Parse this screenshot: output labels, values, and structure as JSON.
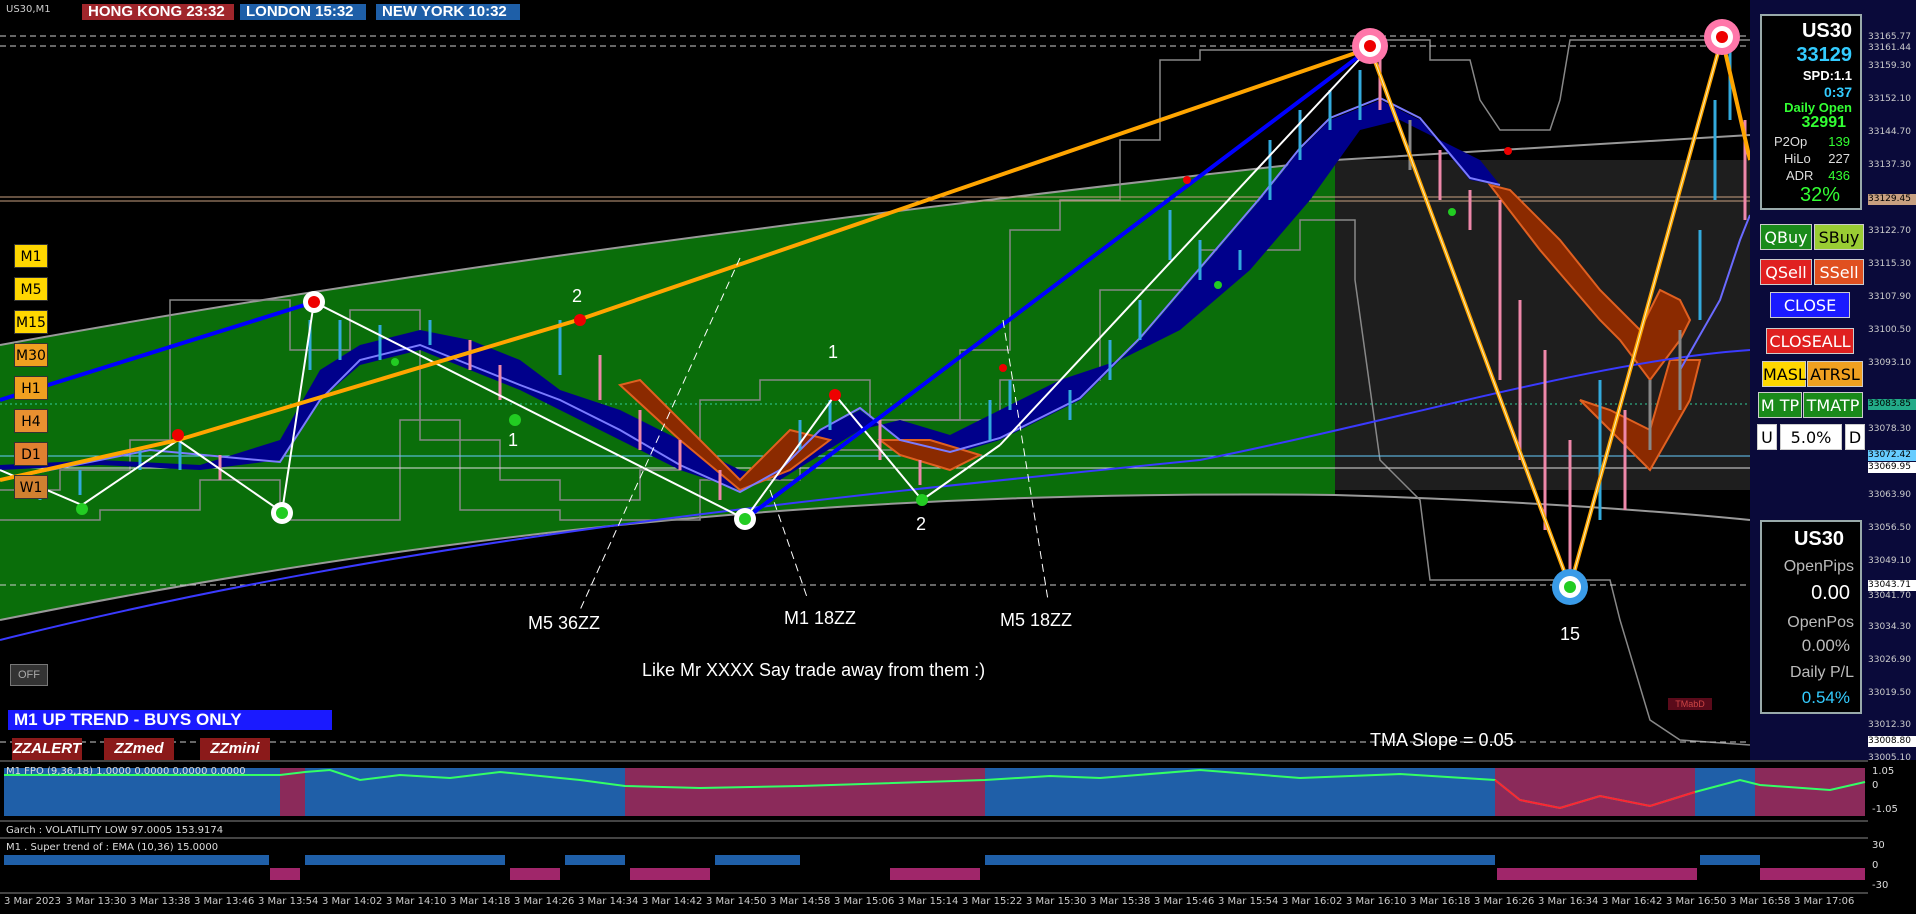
{
  "window": {
    "symbol_label": "US30,M1"
  },
  "clocks": [
    {
      "label": "HONG KONG 23:32",
      "color": "#a0262b"
    },
    {
      "label": "LONDON  15:32",
      "color": "#1e5fa8"
    },
    {
      "label": "NEW YORK  10:32",
      "color": "#1e5fa8"
    }
  ],
  "timeframes": [
    {
      "label": "M1",
      "color": "#ffd700"
    },
    {
      "label": "M5",
      "color": "#ffd700"
    },
    {
      "label": "M15",
      "color": "#ffd700"
    },
    {
      "label": "M30",
      "color": "#f0a020"
    },
    {
      "label": "H1",
      "color": "#f0a020"
    },
    {
      "label": "H4",
      "color": "#e89030"
    },
    {
      "label": "D1",
      "color": "#e08030"
    },
    {
      "label": "W1",
      "color": "#d08030"
    }
  ],
  "off_button": "OFF",
  "trend_banner": "M1 UP TREND - BUYS ONLY",
  "zz_buttons": [
    "ZZALERT",
    "ZZmed",
    "ZZmini"
  ],
  "annotations": {
    "m5_36zz": "M5 36ZZ",
    "m1_18zz": "M1 18ZZ",
    "m5_18zz": "M5 18ZZ",
    "comment": "Like Mr XXXX Say trade away from them :)",
    "tma_slope": "TMA Slope = 0.05",
    "fifteen": "15",
    "label_2a": "2",
    "label_1a": "1",
    "label_1b": "1",
    "label_2b": "2",
    "tma_tag": "TMabD"
  },
  "info_panel": {
    "symbol": "US30",
    "price": "33129",
    "spread": "SPD:1.1",
    "timer": "0:37",
    "daily_open_label": "Daily Open",
    "daily_open": "32991",
    "stats": [
      {
        "label": "P2Op",
        "value": "139"
      },
      {
        "label": "HiLo",
        "value": "227"
      },
      {
        "label": "ADR",
        "value": "436"
      }
    ],
    "percent": "32%"
  },
  "trade_buttons": {
    "qbuy": "QBuy",
    "sbuy": "SBuy",
    "qsell": "QSell",
    "ssell": "SSell",
    "close": "CLOSE",
    "closeall": "CLOSEALL",
    "masl": "MASL",
    "atrsl": "ATRSL",
    "mtp": "M TP",
    "tmatp": "TMATP",
    "u": "U",
    "risk": "5.0%",
    "d": "D"
  },
  "account_panel": {
    "symbol": "US30",
    "open_pips_label": "OpenPips",
    "open_pips": "0.00",
    "open_pos_label": "OpenPos",
    "open_pos": "0.00%",
    "daily_pl_label": "Daily P/L",
    "daily_pl": "0.54%"
  },
  "price_axis": [
    "33165.77",
    "33161.44",
    "33159.30",
    "33152.10",
    "33144.70",
    "33137.30",
    "33129.45",
    "33122.70",
    "33115.30",
    "33107.90",
    "33100.50",
    "33093.10",
    "33083.85",
    "33078.30",
    "33072.42",
    "33069.95",
    "33063.90",
    "33056.50",
    "33049.10",
    "33043.71",
    "33041.70",
    "33034.30",
    "33026.90",
    "33019.50",
    "33012.30",
    "33008.80",
    "33005.10"
  ],
  "subwindows": {
    "rsi_label": "M1 FPO (9,36,18) 1.0000 0.0000 0.0000 0.0000",
    "rsi_scale": [
      "1.05",
      "0",
      "-1.05"
    ],
    "garch_label": "Garch : VOLATILITY LOW 97.0005 153.9174",
    "st_label": "M1 . Super trend of : EMA (10,36) 15.0000",
    "st_scale": [
      "30",
      "0",
      "-30"
    ]
  },
  "time_axis": [
    "3 Mar 2023",
    "3 Mar 13:30",
    "3 Mar 13:38",
    "3 Mar 13:46",
    "3 Mar 13:54",
    "3 Mar 14:02",
    "3 Mar 14:10",
    "3 Mar 14:18",
    "3 Mar 14:26",
    "3 Mar 14:34",
    "3 Mar 14:42",
    "3 Mar 14:50",
    "3 Mar 14:58",
    "3 Mar 15:06",
    "3 Mar 15:14",
    "3 Mar 15:22",
    "3 Mar 15:30",
    "3 Mar 15:38",
    "3 Mar 15:46",
    "3 Mar 15:54",
    "3 Mar 16:02",
    "3 Mar 16:10",
    "3 Mar 16:18",
    "3 Mar 16:26",
    "3 Mar 16:34",
    "3 Mar 16:42",
    "3 Mar 16:50",
    "3 Mar 16:58",
    "3 Mar 17:06"
  ],
  "colors": {
    "band_green": "#0a6e0a",
    "cloud_blue": "#00008b",
    "cloud_orange": "#8b2a00",
    "zigzag_orange": "#ffa500",
    "zigzag_blue": "#0000ff"
  }
}
